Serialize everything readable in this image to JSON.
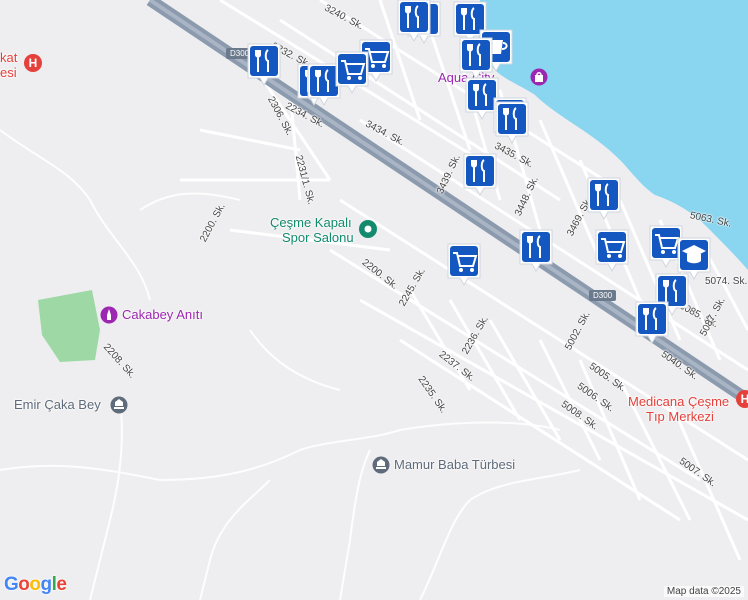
{
  "colors": {
    "water": "#8ad5ef",
    "highway": "#8c9aae",
    "road": "#ffffff",
    "park": "#9ed9a5",
    "poi_blue": "#1557c0",
    "poi_green": "#138a6e",
    "poi_purple": "#9c27b0",
    "poi_gray": "#5e6b7b",
    "medical": "#e5403b"
  },
  "highway": {
    "ref": "D300"
  },
  "streets": [
    "3240. Sk.",
    "3232. Sk.",
    "3434. Sk.",
    "3435. Sk.",
    "3439. Sk.",
    "3448. Sk.",
    "2306. Sk.",
    "2234. Sk.",
    "2231/1. Sk.",
    "2200. Sk.",
    "2200. Sk.",
    "2245. Sk.",
    "2236. Sk.",
    "2237. Sk.",
    "2235. Sk.",
    "2208. Sk.",
    "5063. Sk.",
    "5074. Sk.",
    "5085. Sk.",
    "5087. Sk.",
    "5040. Sk.",
    "5002. Sk.",
    "5005. Sk.",
    "5006. Sk.",
    "5008. Sk.",
    "5007. Sk.",
    "3469. Sk."
  ],
  "places": {
    "sports_hall": {
      "line1": "Çeşme Kapalı",
      "line2": "Spor Salonu",
      "icon": "park-marker-icon"
    },
    "monument": {
      "name": "Cakabey Anıtı",
      "icon": "monument-icon"
    },
    "mosque": {
      "name": "Emir Çaka Bey",
      "icon": "landmark-icon"
    },
    "tomb": {
      "name": "Mamur Baba Türbesi",
      "icon": "landmark-icon"
    },
    "mall": {
      "name": "Aqua City",
      "icon": "shopping-icon"
    },
    "hospital_right": {
      "line1": "Medicana Çeşme",
      "line2": "Tıp Merkezi",
      "icon": "hospital-icon"
    },
    "hospital_left": {
      "line1": "kat",
      "line2": "esi",
      "icon": "hospital-icon"
    }
  },
  "markers": [
    "restaurant-icon",
    "shopping-cart-icon",
    "restaurant-icon",
    "restaurant-icon",
    "shopping-cart-icon",
    "restaurant-icon",
    "restaurant-icon",
    "restaurant-icon",
    "cafe-icon",
    "restaurant-icon",
    "restaurant-icon",
    "restaurant-icon",
    "restaurant-icon",
    "restaurant-icon",
    "restaurant-icon",
    "shopping-cart-icon",
    "restaurant-icon",
    "shopping-cart-icon",
    "shopping-cart-icon",
    "school-icon",
    "restaurant-icon",
    "restaurant-icon"
  ],
  "footer": {
    "logo": "Google",
    "attribution": "Map data ©2025"
  }
}
